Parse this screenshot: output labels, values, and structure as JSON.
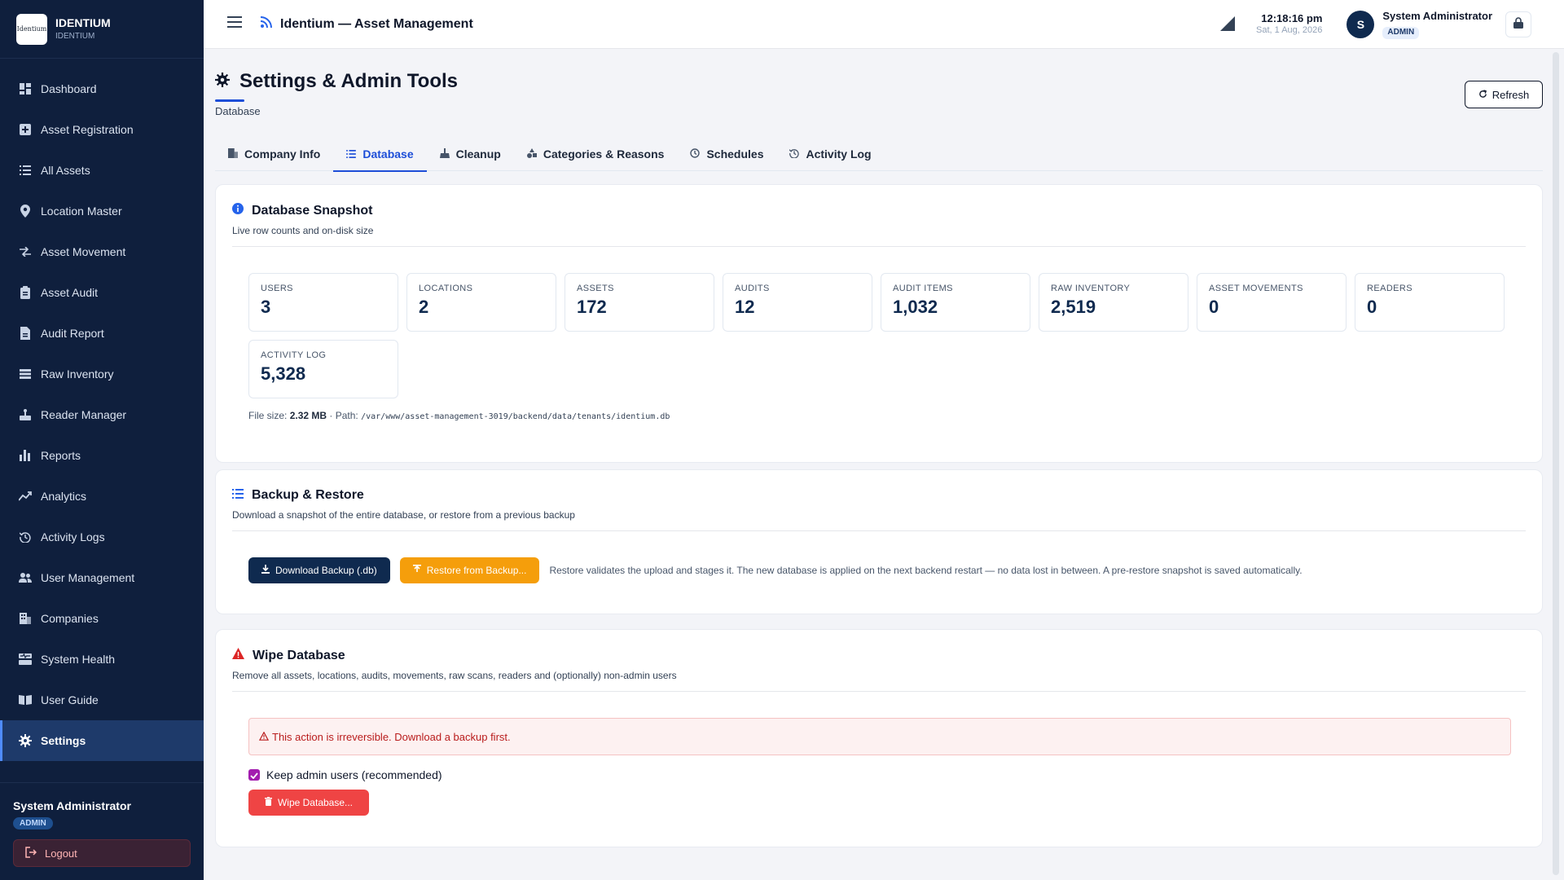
{
  "brand": {
    "logo_text": "Identium",
    "name": "IDENTIUM",
    "sub": "IDENTIUM"
  },
  "sidebar": {
    "items": [
      {
        "label": "Dashboard",
        "icon": "dashboard-icon"
      },
      {
        "label": "Asset Registration",
        "icon": "plus-square-icon"
      },
      {
        "label": "All Assets",
        "icon": "list-icon"
      },
      {
        "label": "Location Master",
        "icon": "map-pin-icon"
      },
      {
        "label": "Asset Movement",
        "icon": "swap-icon"
      },
      {
        "label": "Asset Audit",
        "icon": "clipboard-icon"
      },
      {
        "label": "Audit Report",
        "icon": "file-icon"
      },
      {
        "label": "Raw Inventory",
        "icon": "database-icon"
      },
      {
        "label": "Reader Manager",
        "icon": "reader-icon"
      },
      {
        "label": "Reports",
        "icon": "bar-chart-icon"
      },
      {
        "label": "Analytics",
        "icon": "trend-icon"
      },
      {
        "label": "Activity Logs",
        "icon": "history-icon"
      },
      {
        "label": "User Management",
        "icon": "users-icon"
      },
      {
        "label": "Companies",
        "icon": "building-icon"
      },
      {
        "label": "System Health",
        "icon": "server-icon"
      },
      {
        "label": "User Guide",
        "icon": "book-icon"
      },
      {
        "label": "Settings",
        "icon": "gear-icon",
        "active": true
      }
    ],
    "footer_user": "System Administrator",
    "footer_role": "ADMIN",
    "logout_label": "Logout"
  },
  "topbar": {
    "title": "Identium — Asset Management",
    "time": "12:18:16 pm",
    "date": "Sat, 1 Aug, 2026",
    "avatar_initial": "S",
    "user_name": "System Administrator",
    "user_role": "ADMIN"
  },
  "page": {
    "title": "Settings & Admin Tools",
    "subtitle": "Database",
    "refresh_label": "Refresh"
  },
  "tabs": [
    {
      "label": "Company Info",
      "icon": "building-icon"
    },
    {
      "label": "Database",
      "icon": "list-icon",
      "active": true
    },
    {
      "label": "Cleanup",
      "icon": "broom-icon"
    },
    {
      "label": "Categories & Reasons",
      "icon": "shapes-icon"
    },
    {
      "label": "Schedules",
      "icon": "clock-icon"
    },
    {
      "label": "Activity Log",
      "icon": "history-icon"
    }
  ],
  "snapshot": {
    "title": "Database Snapshot",
    "desc": "Live row counts and on-disk size",
    "stats": [
      {
        "label": "USERS",
        "value": "3"
      },
      {
        "label": "LOCATIONS",
        "value": "2"
      },
      {
        "label": "ASSETS",
        "value": "172"
      },
      {
        "label": "AUDITS",
        "value": "12"
      },
      {
        "label": "AUDIT ITEMS",
        "value": "1,032"
      },
      {
        "label": "RAW INVENTORY",
        "value": "2,519"
      },
      {
        "label": "ASSET MOVEMENTS",
        "value": "0"
      },
      {
        "label": "READERS",
        "value": "0"
      },
      {
        "label": "ACTIVITY LOG",
        "value": "5,328"
      }
    ],
    "file_size_label": "File size:",
    "file_size": "2.32 MB",
    "path_label": "· Path:",
    "path": "/var/www/asset-management-3019/backend/data/tenants/identium.db"
  },
  "backup": {
    "title": "Backup & Restore",
    "desc": "Download a snapshot of the entire database, or restore from a previous backup",
    "download_label": "Download Backup (.db)",
    "restore_label": "Restore from Backup...",
    "note": "Restore validates the upload and stages it. The new database is applied on the next backend restart — no data lost in between. A pre-restore snapshot is saved automatically."
  },
  "wipe": {
    "title": "Wipe Database",
    "desc": "Remove all assets, locations, audits, movements, raw scans, readers and (optionally) non-admin users",
    "alert": "This action is irreversible. Download a backup first.",
    "keep_admin_label": "Keep admin users (recommended)",
    "keep_admin_checked": true,
    "wipe_label": "Wipe Database..."
  },
  "colors": {
    "sidebar_bg": "#0f1f3d",
    "accent": "#1d4ed8",
    "amber": "#f59e0b",
    "danger": "#ef4444"
  }
}
